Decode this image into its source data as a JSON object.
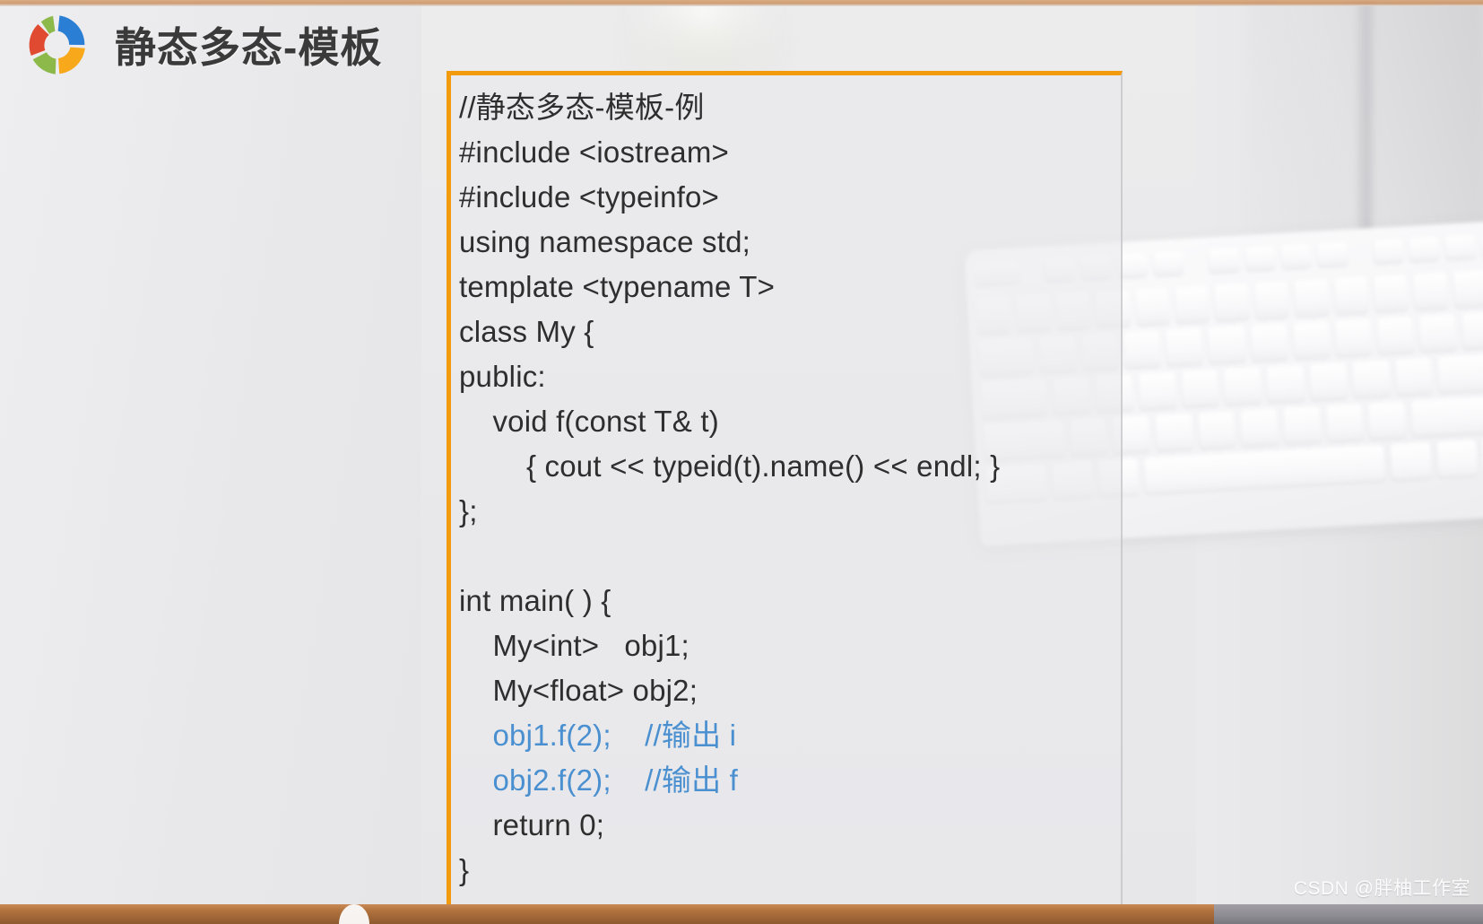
{
  "slide": {
    "title": "静态多态-模板",
    "logo_icon": "donut-ring-logo",
    "logo_colors": {
      "blue": "#2a7fd4",
      "orange": "#f7a81b",
      "green": "#8cb94a",
      "red": "#e04a31"
    },
    "accent_color": "#f29b0c",
    "code_highlight_color": "#4a90d0",
    "background": "blurred desk photo with white keyboard"
  },
  "code_block": {
    "language": "cpp",
    "border_color": "#f29b0c",
    "lines": [
      {
        "text": "//静态多态-模板-例",
        "style": "normal"
      },
      {
        "text": "#include <iostream>",
        "style": "normal"
      },
      {
        "text": "#include <typeinfo>",
        "style": "normal"
      },
      {
        "text": "using namespace std;",
        "style": "normal"
      },
      {
        "text": "template <typename T>",
        "style": "normal"
      },
      {
        "text": "class My {",
        "style": "normal"
      },
      {
        "text": "public:",
        "style": "normal"
      },
      {
        "text": "    void f(const T& t)",
        "style": "normal"
      },
      {
        "text": "        { cout << typeid(t).name() << endl; }",
        "style": "normal"
      },
      {
        "text": "};",
        "style": "normal"
      },
      {
        "text": "",
        "style": "blank"
      },
      {
        "text": "int main( ) {",
        "style": "normal"
      },
      {
        "text": "    My<int>   obj1;",
        "style": "normal"
      },
      {
        "text": "    My<float> obj2;",
        "style": "normal"
      },
      {
        "text": "    obj1.f(2);    //输出 i",
        "style": "blue"
      },
      {
        "text": "    obj2.f(2);    //输出 f",
        "style": "blue"
      },
      {
        "text": "    return 0;",
        "style": "normal"
      },
      {
        "text": "}",
        "style": "normal"
      }
    ]
  },
  "watermark": {
    "text": "CSDN @胖柚工作室"
  }
}
